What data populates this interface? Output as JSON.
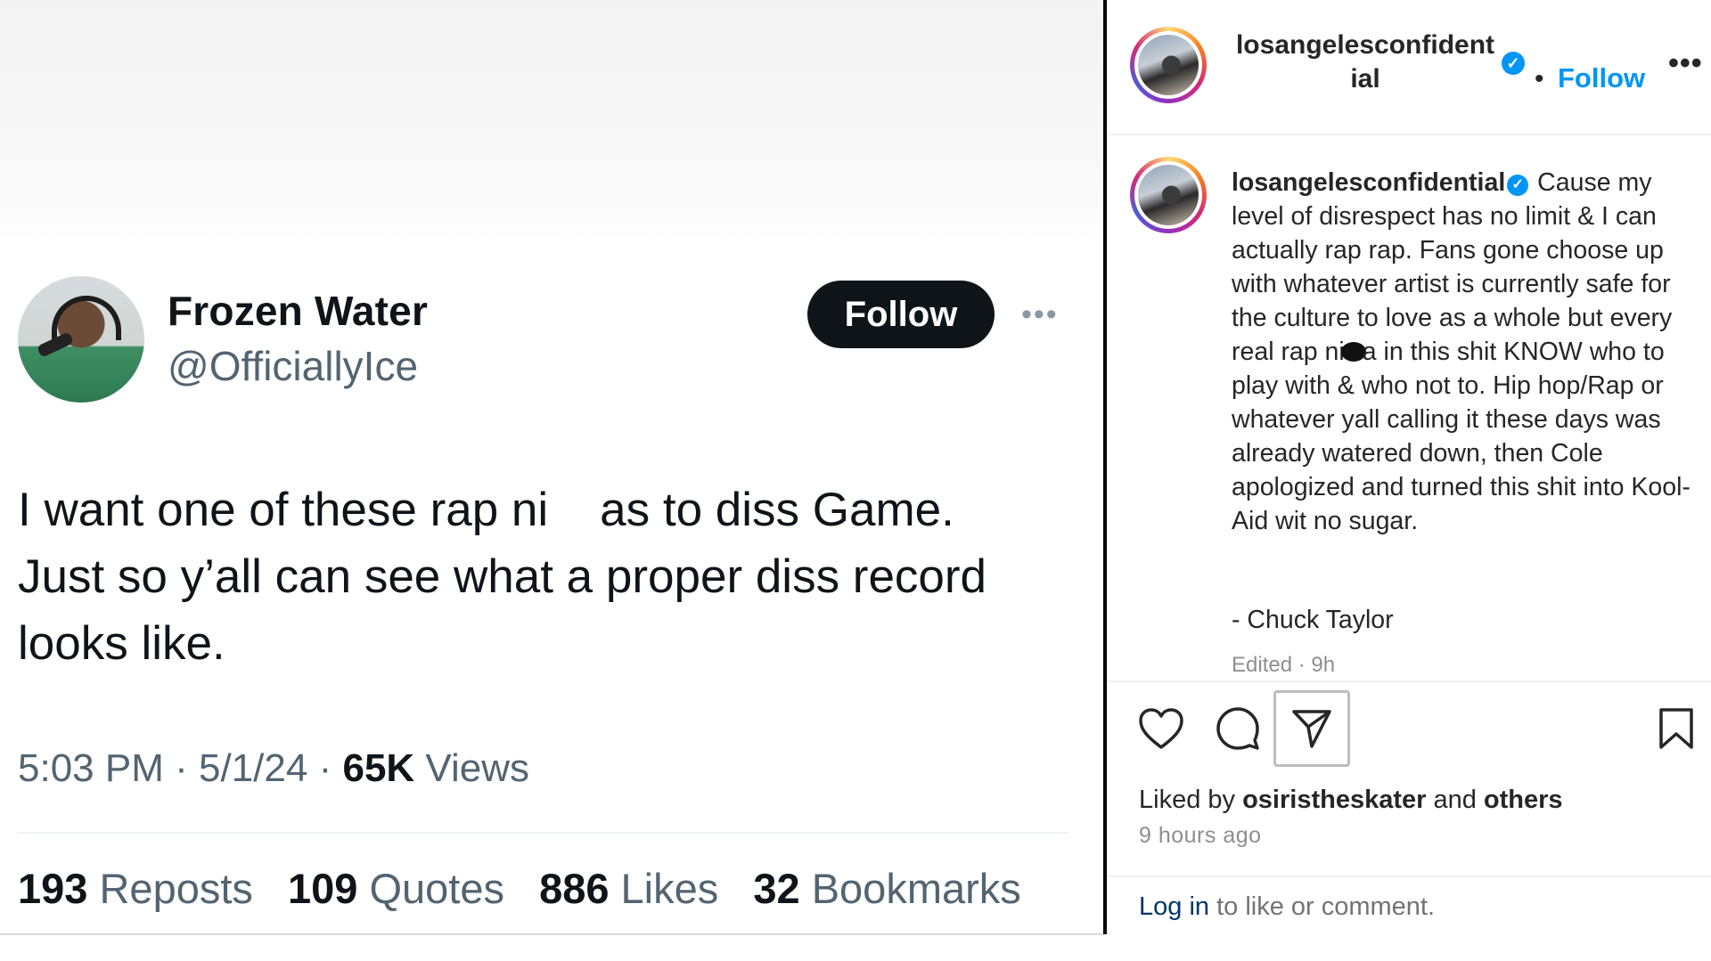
{
  "tweet": {
    "display_name": "Frozen Water",
    "handle": "@OfficiallyIce",
    "follow_label": "Follow",
    "more_label": "•••",
    "text_part1": "I want one of these rap ni",
    "text_part2": "as to diss Game.",
    "text_line2": "Just so y’all can see what a proper diss record",
    "text_line3": "looks like.",
    "time": "5:03 PM",
    "date": "5/1/24",
    "separator": "·",
    "views_count": "65K",
    "views_label": "Views",
    "stats": [
      {
        "count": "193",
        "label": "Reposts"
      },
      {
        "count": "109",
        "label": "Quotes"
      },
      {
        "count": "886",
        "label": "Likes"
      },
      {
        "count": "32",
        "label": "Bookmarks"
      }
    ]
  },
  "instagram": {
    "header": {
      "username_line1": "losangelesconfident",
      "username_line2": "ial",
      "verified_glyph": "✓",
      "dot": "•",
      "follow_label": "Follow",
      "more_label": "•••"
    },
    "caption": {
      "username": "losangelesconfidential",
      "text_before": "Cause my level of disrespect has no limit & I can actually rap rap. Fans gone choose up with whatever artist is currently safe for the culture to love as a whole but every real rap ni",
      "text_after": "a in this shit KNOW who to play with & who not to. Hip hop/Rap or whatever yall calling it these days was already watered down, then Cole apologized and turned this shit into Kool-Aid wit no sugar.",
      "signature": "- Chuck Taylor",
      "edited": "Edited · 9h"
    },
    "actions": {
      "like_icon": "heart-icon",
      "comment_icon": "comment-icon",
      "share_icon": "share-icon",
      "save_icon": "bookmark-icon"
    },
    "likes": {
      "prefix": "Liked by",
      "user": "osiristheskater",
      "middle": "and",
      "others": "others"
    },
    "time_ago": "9 hours ago",
    "login": {
      "link": "Log in",
      "rest": "to like or comment."
    },
    "colors": {
      "link_blue": "#0095f6",
      "login_link": "#00376b"
    }
  }
}
